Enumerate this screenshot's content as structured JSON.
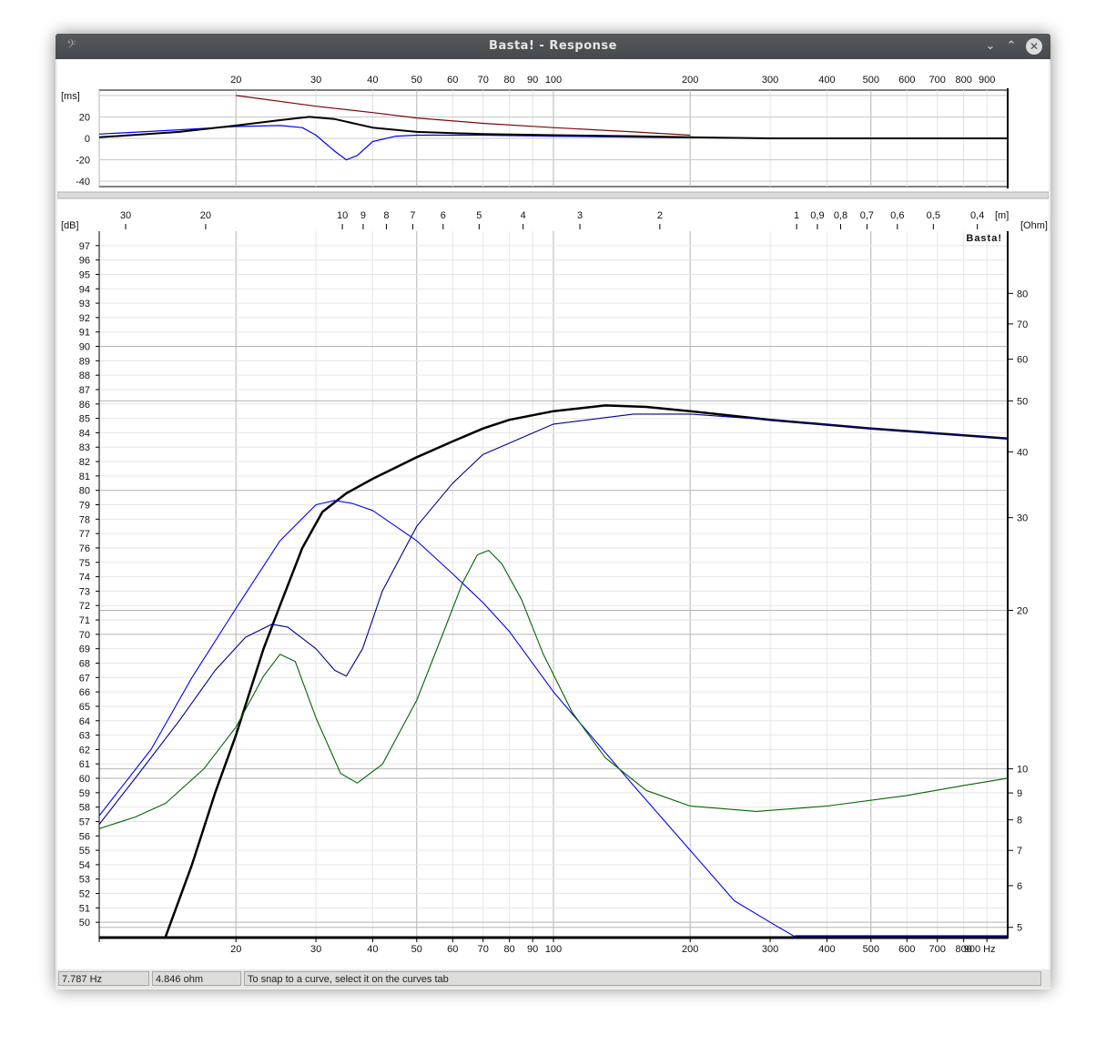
{
  "window": {
    "title": "Basta! - Response",
    "minimize_icon": "chevron-down-icon",
    "maximize_icon": "chevron-up-icon",
    "close_icon": "close-icon",
    "app_icon": "bass-clef-icon"
  },
  "statusbar": {
    "frequency": "7.787 Hz",
    "impedance": "4.846 ohm",
    "hint": "To snap to a curve, select it on the curves tab"
  },
  "watermark": "Basta!",
  "colors": {
    "black": "#000000",
    "blue": "#0000ff",
    "navy": "#0a0a80",
    "green": "#006400",
    "darkred": "#7a0a0a",
    "grid": "#c8c8c8"
  },
  "chart_data": [
    {
      "type": "line",
      "xscale": "log",
      "x_tick_labels": [
        "20",
        "30",
        "40",
        "50",
        "60",
        "70",
        "80",
        "90",
        "100",
        "200",
        "300",
        "400",
        "500",
        "600",
        "700",
        "800",
        "900"
      ],
      "ylabel": "[ms]",
      "ylim": [
        -45,
        45
      ],
      "y_tick_labels": [
        "20",
        "0",
        "-20",
        "-40"
      ],
      "series": [
        {
          "color": "#0000ff",
          "points": [
            [
              10,
              4
            ],
            [
              15,
              8
            ],
            [
              20,
              11
            ],
            [
              25,
              12
            ],
            [
              28,
              10
            ],
            [
              30,
              3
            ],
            [
              33,
              -12
            ],
            [
              35,
              -20
            ],
            [
              37,
              -16
            ],
            [
              40,
              -3
            ],
            [
              45,
              2
            ],
            [
              50,
              3
            ],
            [
              70,
              3
            ],
            [
              100,
              2
            ],
            [
              200,
              0.5
            ],
            [
              500,
              0
            ],
            [
              1000,
              0
            ]
          ]
        },
        {
          "color": "#000000",
          "points": [
            [
              10,
              1
            ],
            [
              15,
              6
            ],
            [
              20,
              12
            ],
            [
              25,
              17
            ],
            [
              29,
              20
            ],
            [
              33,
              18
            ],
            [
              40,
              10
            ],
            [
              50,
              6
            ],
            [
              70,
              4
            ],
            [
              100,
              3
            ],
            [
              150,
              2
            ],
            [
              200,
              1
            ],
            [
              300,
              0
            ],
            [
              1000,
              0
            ]
          ]
        },
        {
          "color": "#7a0a0a",
          "points": [
            [
              20,
              40
            ],
            [
              30,
              30
            ],
            [
              40,
              24
            ],
            [
              50,
              19
            ],
            [
              70,
              14
            ],
            [
              100,
              10
            ],
            [
              150,
              6
            ],
            [
              200,
              3
            ]
          ]
        }
      ]
    },
    {
      "type": "line",
      "xscale": "log",
      "xlim": [
        10,
        1000
      ],
      "x_tick_labels": [
        "20",
        "30",
        "40",
        "50",
        "60",
        "70",
        "80",
        "90",
        "100",
        "200",
        "300",
        "400",
        "500",
        "600",
        "700",
        "800",
        "900 Hz"
      ],
      "wavelength_axis_unit": "[m]",
      "wavelength_tick_labels": [
        "30",
        "20",
        "10",
        "9",
        "8",
        "7",
        "6",
        "5",
        "4",
        "3",
        "2",
        "1",
        "0,9",
        "0,8",
        "0,7",
        "0,6",
        "0,5",
        "0,4"
      ],
      "ylabel": "[dB]",
      "ylim": [
        49,
        98
      ],
      "y_tick_labels": [
        "50",
        "51",
        "52",
        "53",
        "54",
        "55",
        "56",
        "57",
        "58",
        "59",
        "60",
        "61",
        "62",
        "63",
        "64",
        "65",
        "66",
        "67",
        "68",
        "69",
        "70",
        "71",
        "72",
        "73",
        "74",
        "75",
        "76",
        "77",
        "78",
        "79",
        "80",
        "81",
        "82",
        "83",
        "84",
        "85",
        "86",
        "87",
        "88",
        "89",
        "90",
        "91",
        "92",
        "93",
        "94",
        "95",
        "96",
        "97"
      ],
      "y2label": "[Ohm]",
      "y2scale": "log",
      "y2_tick_labels": [
        "5",
        "6",
        "7",
        "8",
        "9",
        "10",
        "20",
        "30",
        "40",
        "50",
        "60",
        "70",
        "80"
      ],
      "series": [
        {
          "color": "#000000",
          "width": 2.5,
          "points": [
            [
              14,
              49
            ],
            [
              16,
              54
            ],
            [
              18,
              59
            ],
            [
              20,
              63
            ],
            [
              23,
              69
            ],
            [
              25,
              72
            ],
            [
              28,
              76
            ],
            [
              31,
              78.5
            ],
            [
              35,
              79.8
            ],
            [
              40,
              80.8
            ],
            [
              50,
              82.3
            ],
            [
              60,
              83.4
            ],
            [
              70,
              84.3
            ],
            [
              80,
              84.9
            ],
            [
              100,
              85.5
            ],
            [
              130,
              85.9
            ],
            [
              160,
              85.8
            ],
            [
              200,
              85.5
            ],
            [
              300,
              84.9
            ],
            [
              500,
              84.3
            ],
            [
              1000,
              83.6
            ]
          ]
        },
        {
          "color": "#00008b",
          "points": [
            [
              10,
              56.8
            ],
            [
              12,
              60
            ],
            [
              15,
              64
            ],
            [
              18,
              67.5
            ],
            [
              21,
              69.8
            ],
            [
              24,
              70.7
            ],
            [
              26,
              70.5
            ],
            [
              30,
              69
            ],
            [
              33,
              67.5
            ],
            [
              35,
              67.1
            ],
            [
              38,
              69
            ],
            [
              42,
              73
            ],
            [
              50,
              77.5
            ],
            [
              60,
              80.5
            ],
            [
              70,
              82.5
            ],
            [
              100,
              84.6
            ],
            [
              150,
              85.3
            ],
            [
              200,
              85.3
            ],
            [
              300,
              84.9
            ],
            [
              500,
              84.3
            ],
            [
              1000,
              83.6
            ]
          ]
        },
        {
          "color": "#0000ff",
          "points": [
            [
              10,
              57.4
            ],
            [
              13,
              62
            ],
            [
              16,
              67
            ],
            [
              20,
              71.8
            ],
            [
              25,
              76.5
            ],
            [
              30,
              79
            ],
            [
              33,
              79.3
            ],
            [
              36,
              79.1
            ],
            [
              40,
              78.6
            ],
            [
              50,
              76.5
            ],
            [
              60,
              74.2
            ],
            [
              70,
              72.2
            ],
            [
              80,
              70.2
            ],
            [
              100,
              66
            ],
            [
              150,
              59.5
            ],
            [
              200,
              55
            ],
            [
              250,
              51.5
            ],
            [
              300,
              50
            ],
            [
              340,
              49
            ]
          ]
        },
        {
          "color": "#006400",
          "ohm": true,
          "points": [
            [
              10,
              7.7
            ],
            [
              12,
              8.1
            ],
            [
              14,
              8.6
            ],
            [
              17,
              10
            ],
            [
              20,
              12
            ],
            [
              23,
              15
            ],
            [
              25,
              16.5
            ],
            [
              27,
              16
            ],
            [
              30,
              12.5
            ],
            [
              34,
              9.8
            ],
            [
              37,
              9.4
            ],
            [
              42,
              10.2
            ],
            [
              50,
              13.5
            ],
            [
              57,
              18
            ],
            [
              63,
              22.5
            ],
            [
              68,
              25.5
            ],
            [
              72,
              26
            ],
            [
              77,
              24.5
            ],
            [
              85,
              21
            ],
            [
              95,
              16.5
            ],
            [
              110,
              12.8
            ],
            [
              130,
              10.5
            ],
            [
              160,
              9.1
            ],
            [
              200,
              8.5
            ],
            [
              280,
              8.3
            ],
            [
              400,
              8.5
            ],
            [
              600,
              8.9
            ],
            [
              800,
              9.3
            ],
            [
              1000,
              9.6
            ]
          ]
        }
      ]
    }
  ]
}
